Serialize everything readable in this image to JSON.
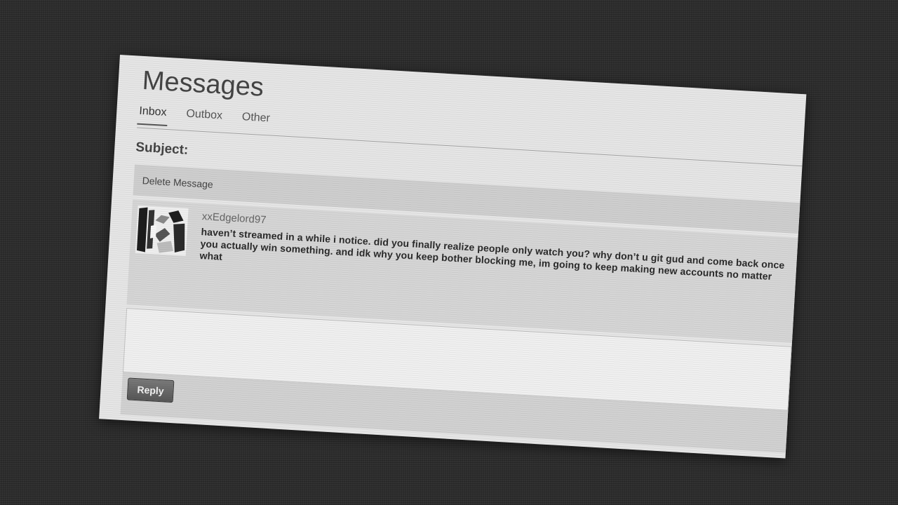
{
  "page": {
    "title": "Messages"
  },
  "tabs": [
    {
      "label": "Inbox",
      "active": true
    },
    {
      "label": "Outbox",
      "active": false
    },
    {
      "label": "Other",
      "active": false
    }
  ],
  "subject_label": "Subject:",
  "toolbar": {
    "delete_label": "Delete Message"
  },
  "message": {
    "sender": "xxEdgelord97",
    "body": "haven’t streamed in a while i notice. did you finally realize people only watch you? why don’t u git gud and come back once you actually win something. and idk why you keep bother blocking me, im going to keep making new accounts no matter what"
  },
  "reply": {
    "button_label": "Reply"
  }
}
